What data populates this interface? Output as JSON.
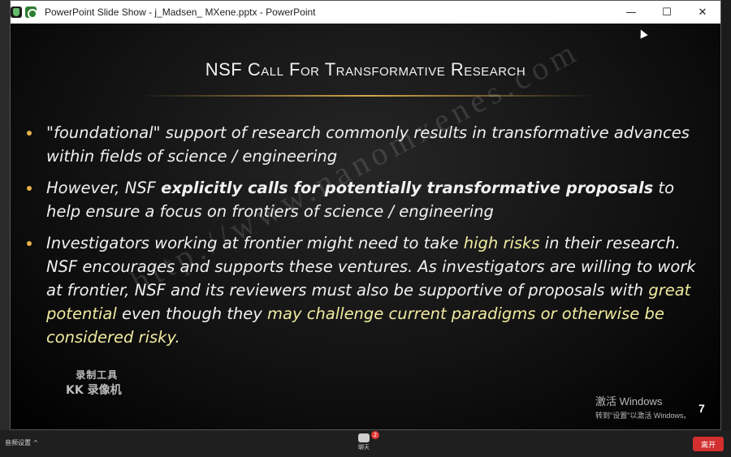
{
  "window": {
    "title": "PowerPoint Slide Show  -  j_Madsen_ MXene.pptx - PowerPoint",
    "controls": {
      "minimize": "—",
      "maximize": "☐",
      "close": "✕"
    }
  },
  "slide": {
    "title": "NSF Call For Transformative Research",
    "bullets": [
      {
        "text": "\"foundational\" support of research commonly results in transformative advances within fields of science / engineering"
      },
      {
        "pre": "However, NSF ",
        "bold": "explicitly calls for potentially transformative proposals",
        "post": " to help ensure a focus on frontiers of science / engineering"
      },
      {
        "p1": "Investigators working at frontier might need to take ",
        "h1": "high risks",
        "p2": " in their research. NSF encourages and supports these ventures. As investigators are willing to work at frontier, NSF and its reviewers must also be supportive of proposals with ",
        "h2": "great potential",
        "p3": " even though they ",
        "h3": "may challenge current paradigms or otherwise be considered risky.",
        "p4": ""
      }
    ],
    "watermark": "http://www.nanomxenes.com",
    "recorder_logo": {
      "line1": "录制工具",
      "line2": "KK 录像机"
    },
    "activation_notice": {
      "line1": "激活 Windows",
      "line2": "转到\"设置\"以激活 Windows。"
    },
    "slide_number": "7"
  },
  "meeting_bar": {
    "audio_settings": "音频设置  ^",
    "chat_label": "聊天",
    "chat_badge": "2",
    "leave_button": "离开"
  },
  "colors": {
    "bullet": "#e8b04a",
    "highlight": "#f0eaa0",
    "leave": "#d32f2f"
  }
}
